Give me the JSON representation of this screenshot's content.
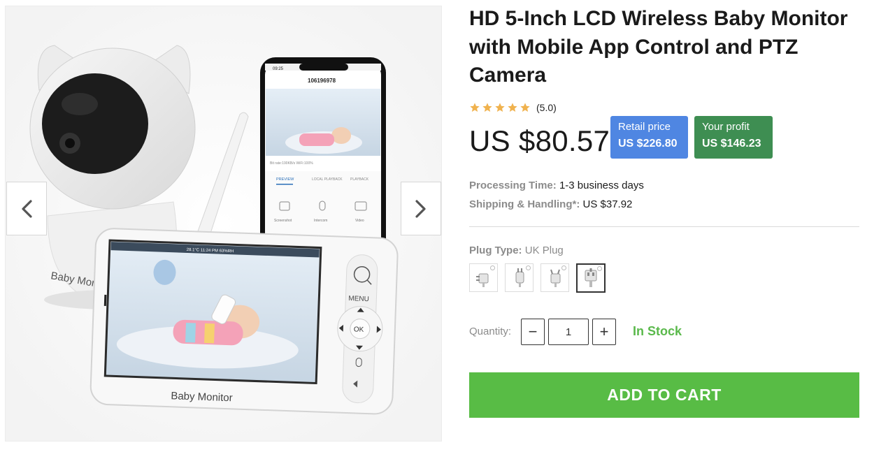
{
  "product": {
    "title": "HD 5-Inch LCD Wireless Baby Monitor with Mobile App Control and PTZ Camera",
    "rating_value": 5,
    "rating_text": "(5.0)",
    "price": "US $80.57",
    "retail_label": "Retail price",
    "retail_value": "US $226.80",
    "profit_label": "Your profit",
    "profit_value": "US $146.23"
  },
  "shipping": {
    "processing_label": "Processing Time:",
    "processing_value": "1-3 business days",
    "shipping_label": "Shipping & Handling*:",
    "shipping_value": "US $37.92"
  },
  "plug": {
    "label": "Plug Type:",
    "selected": "UK Plug",
    "options": [
      "US Plug",
      "EU Plug",
      "AU Plug",
      "UK Plug"
    ],
    "selected_index": 3
  },
  "quantity": {
    "label": "Quantity:",
    "value": "1",
    "minus": "−",
    "plus": "+"
  },
  "stock_status": "In Stock",
  "cta": {
    "add_to_cart": "ADD TO CART"
  },
  "gallery": {
    "prev_icon": "chevron-left-icon",
    "next_icon": "chevron-right-icon",
    "image_text": {
      "camera_brand": "Baby Monitor",
      "monitor_brand": "Baby Monitor",
      "phone_time": "09:25",
      "phone_title": "106196978",
      "phone_stats": "Bit rate:190KB/s      WiFi:100%",
      "phone_tabs": [
        "PREVIEW",
        "LOCAL PLAYBACK",
        "PLAYBACK"
      ],
      "phone_actions": [
        "Screenshot",
        "Intercom",
        "Video"
      ],
      "monitor_status": "28.1°C      11:24 PM      63%RH",
      "monitor_menu": "MENU",
      "monitor_ok": "OK"
    }
  },
  "colors": {
    "cta": "#58bc45",
    "retail_badge": "#4f86e2",
    "profit_badge": "#3e8e52",
    "stock": "#5ab94b",
    "star": "#f0b24e"
  }
}
